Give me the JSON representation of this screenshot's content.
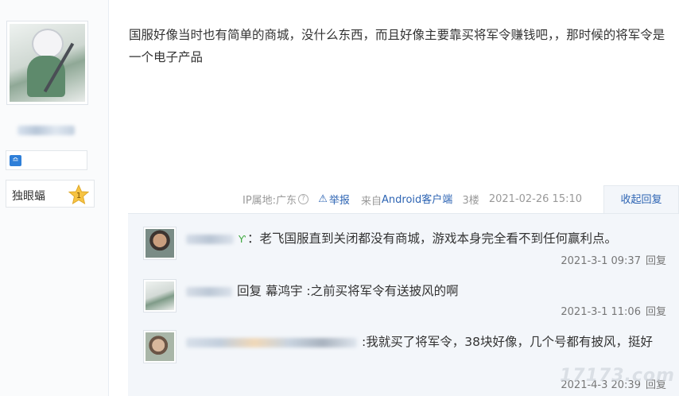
{
  "author": {
    "nickname": "独眼蝠",
    "level": "1",
    "level_badge_icon": "level-badge-icon"
  },
  "post": {
    "content": "国服好像当时也有简单的商城，没什么东西，而且好像主要靠买将军令赚钱吧，，那时候的将军令是一个电子产品",
    "ip_label": "IP属地:广东",
    "report_label": "举报",
    "source_prefix": "来自",
    "source_link": "Android客户端",
    "floor": "3楼",
    "time": "2021-02-26 15:10",
    "collapse_label": "收起回复"
  },
  "replies": [
    {
      "text": "：老飞国服直到关闭都没有商城，游戏本身完全看不到任何赢利点。",
      "time": "2021-3-1 09:37",
      "reply_label": "回复"
    },
    {
      "prefix": "回复 ",
      "target": "幕鸿宇",
      "text": " :之前买将军令有送披风的啊",
      "time": "2021-3-1 11:06",
      "reply_label": "回复"
    },
    {
      "text": ":我就买了将军令，38块好像，几个号都有披风，挺好",
      "time": "2021-4-3 20:39",
      "reply_label": "回复"
    }
  ],
  "watermark": "17173.com",
  "colors": {
    "link": "#2d64b3",
    "reply_bg": "#f3f6fa",
    "badge": "#2f7fd8"
  }
}
